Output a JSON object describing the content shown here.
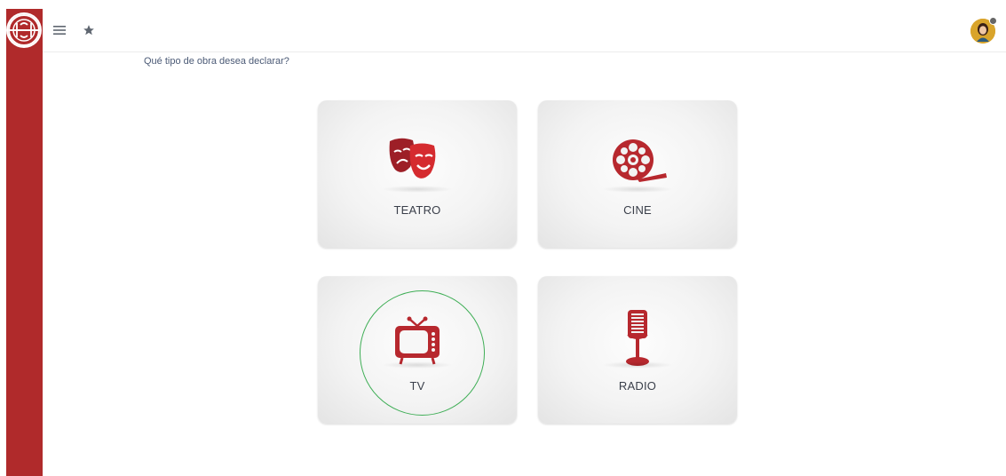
{
  "header": {
    "menu_icon": "hamburger-icon",
    "favorite_icon": "star-icon",
    "avatar_icon": "user-avatar"
  },
  "main": {
    "question": "Qué tipo de obra desea declarar?",
    "cards": [
      {
        "label": "TEATRO",
        "icon": "theater-masks-icon"
      },
      {
        "label": "CINE",
        "icon": "film-reel-icon"
      },
      {
        "label": "TV",
        "icon": "tv-icon"
      },
      {
        "label": "RADIO",
        "icon": "microphone-icon"
      }
    ]
  },
  "colors": {
    "brand": "#b02a2b",
    "icon_red": "#b7282e",
    "focus_ring": "#3fae56",
    "question_text": "#4b5a76"
  }
}
